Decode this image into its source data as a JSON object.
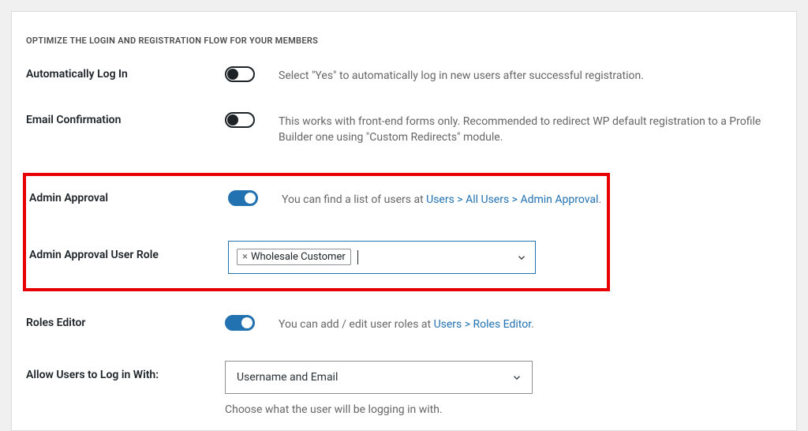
{
  "section_title": "OPTIMIZE THE LOGIN AND REGISTRATION FLOW FOR YOUR MEMBERS",
  "rows": {
    "auto_login": {
      "label": "Automatically Log In",
      "desc": "Select \"Yes\" to automatically log in new users after successful registration."
    },
    "email_confirmation": {
      "label": "Email Confirmation",
      "desc": "This works with front-end forms only. Recommended to redirect WP default registration to a Profile Builder one using \"Custom Redirects\" module."
    },
    "admin_approval": {
      "label": "Admin Approval",
      "desc_prefix": "You can find a list of users at ",
      "link_text": "Users > All Users > Admin Approval",
      "desc_suffix": "."
    },
    "admin_approval_role": {
      "label": "Admin Approval User Role",
      "tag_label": "Wholesale Customer",
      "remove_symbol": "×"
    },
    "roles_editor": {
      "label": "Roles Editor",
      "desc_prefix": "You can add / edit user roles at ",
      "link_text": "Users > Roles Editor",
      "desc_suffix": "."
    },
    "allow_login_with": {
      "label": "Allow Users to Log in With:",
      "selected": "Username and Email",
      "helper": "Choose what the user will be logging in with."
    }
  }
}
